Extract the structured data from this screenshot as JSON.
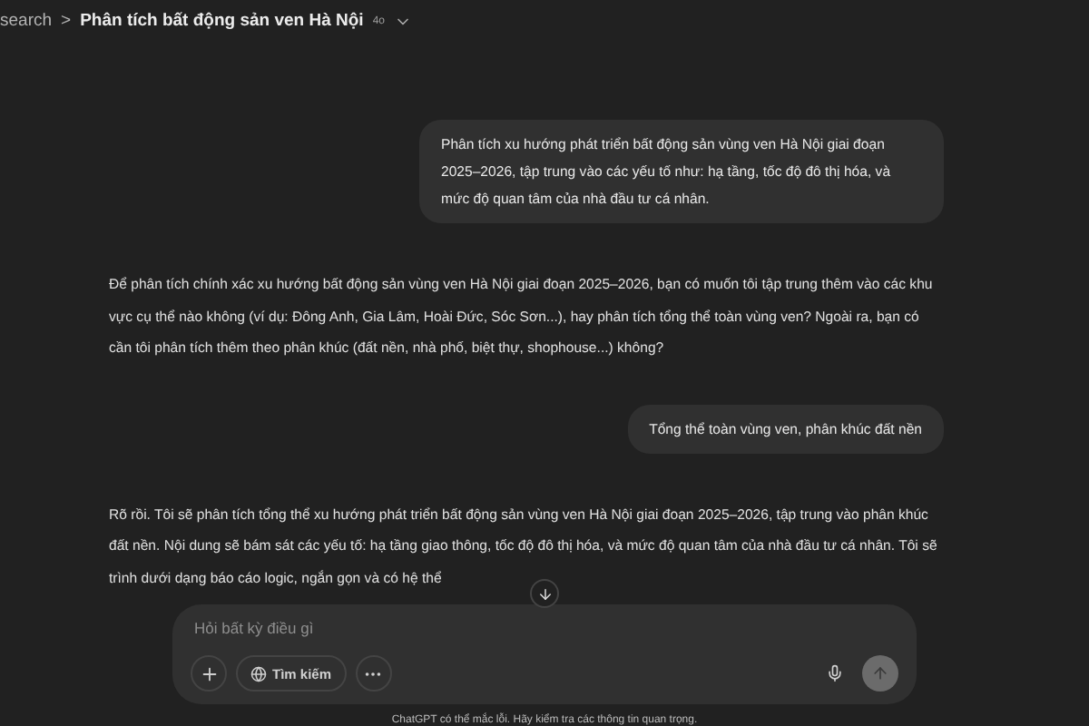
{
  "header": {
    "breadcrumb": "search",
    "separator": ">",
    "title": "Phân tích bất động sản ven Hà Nội",
    "model": "4o"
  },
  "messages": [
    {
      "kind": "user",
      "text": "Phân tích xu hướng phát triển bất động sản vùng ven Hà Nội giai đoạn 2025–2026, tập trung vào các yếu tố như: hạ tầng, tốc độ đô thị hóa, và mức độ quan tâm của nhà đầu tư cá nhân."
    },
    {
      "kind": "assistant",
      "text": "Để phân tích chính xác xu hướng bất động sản vùng ven Hà Nội giai đoạn 2025–2026, bạn có muốn tôi tập trung thêm vào các khu vực cụ thể nào không (ví dụ: Đông Anh, Gia Lâm, Hoài Đức, Sóc Sơn...), hay phân tích tổng thể toàn vùng ven? Ngoài ra, bạn có cần tôi phân tích thêm theo phân khúc (đất nền, nhà phố, biệt thự, shophouse...) không?"
    },
    {
      "kind": "user",
      "text": "Tổng thể toàn vùng ven, phân khúc đất nền"
    },
    {
      "kind": "assistant",
      "text": "Rõ rồi. Tôi sẽ phân tích tổng thể xu hướng phát triển bất động sản vùng ven Hà Nội giai đoạn 2025–2026, tập trung vào phân khúc đất nền. Nội dung sẽ bám sát các yếu tố: hạ tầng giao thông, tốc độ đô thị hóa, và mức độ quan tâm của nhà đầu tư cá nhân. Tôi sẽ trình dưới dạng báo cáo logic, ngắn gọn và có hệ thể"
    }
  ],
  "composer": {
    "placeholder": "Hỏi bất kỳ điều gì",
    "search_label": "Tìm kiếm"
  },
  "footer": "ChatGPT có thể mắc lỗi. Hãy kiểm tra các thông tin quan trọng."
}
